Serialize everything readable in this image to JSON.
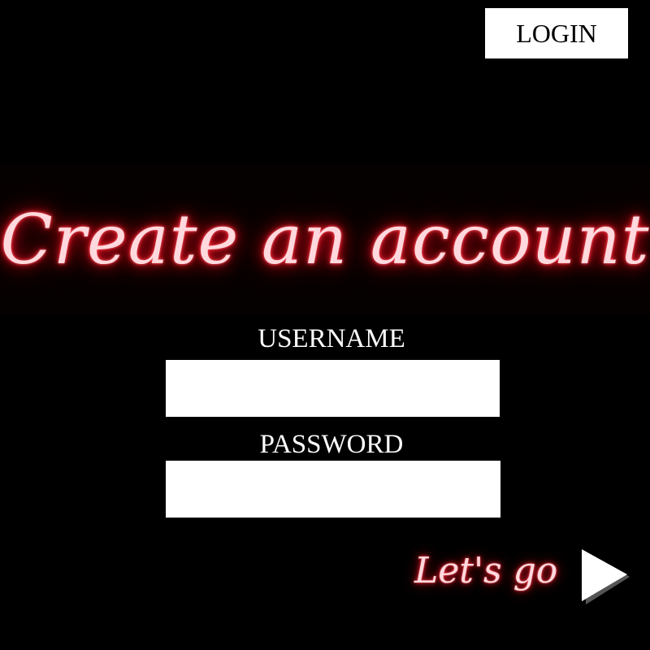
{
  "header": {
    "login_label": "LOGIN"
  },
  "banner": {
    "title": "Create an account"
  },
  "form": {
    "username_label": "USERNAME",
    "username_value": "",
    "password_label": "PASSWORD",
    "password_value": ""
  },
  "footer": {
    "go_label": "Let's go",
    "go_icon": "play-arrow-icon"
  },
  "colors": {
    "background": "#000000",
    "neon_glow": "#ff2030",
    "neon_core": "#ffd9dd",
    "button_bg": "#ffffff",
    "input_bg": "#ffffff"
  }
}
